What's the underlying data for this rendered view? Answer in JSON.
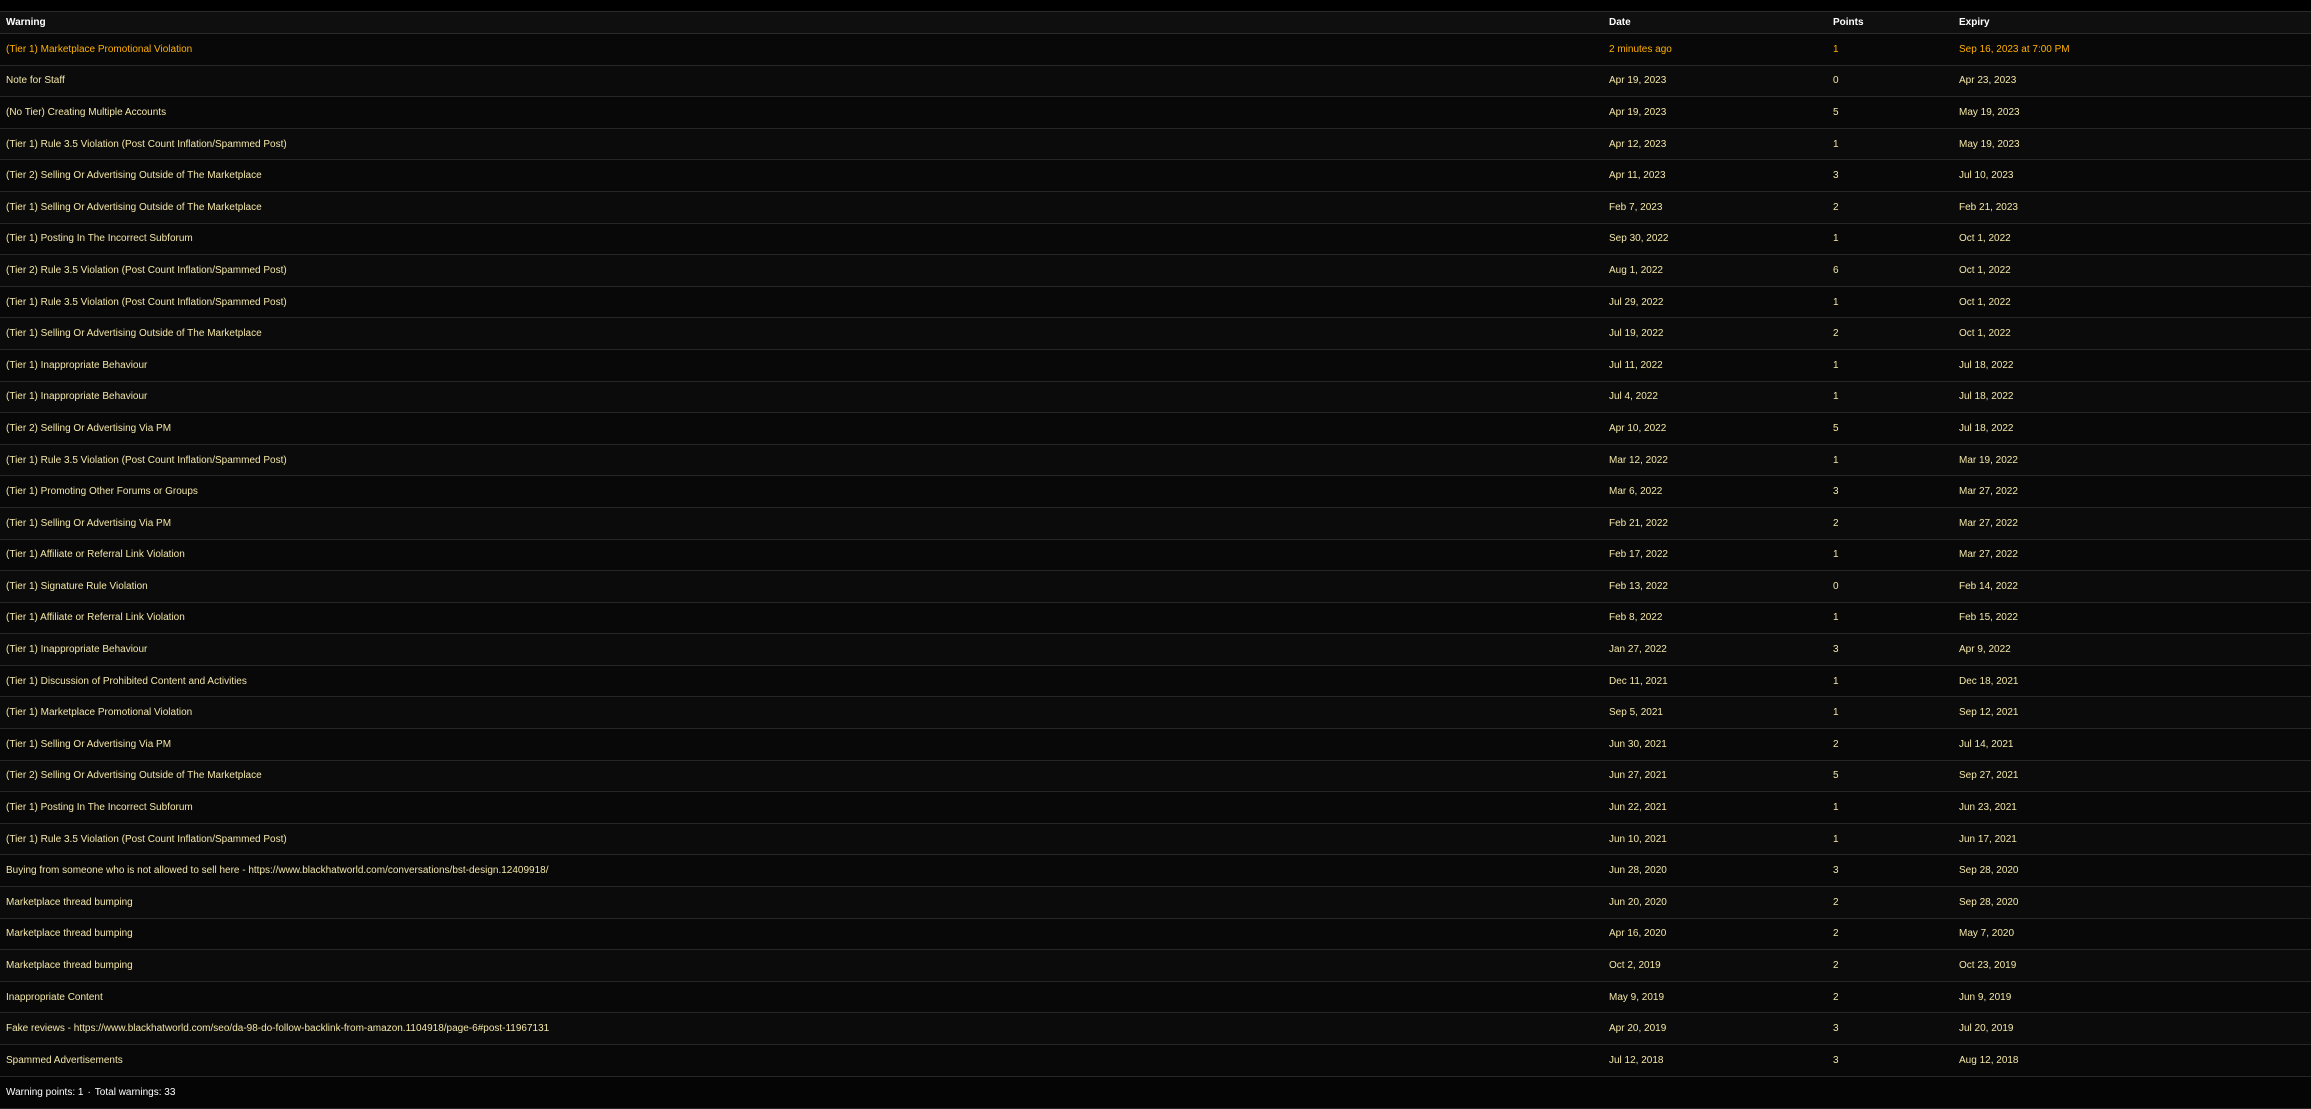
{
  "table": {
    "headers": {
      "warning": "Warning",
      "date": "Date",
      "points": "Points",
      "expiry": "Expiry"
    },
    "rows": [
      {
        "warning": "(Tier 1) Marketplace Promotional Violation",
        "date": "2 minutes ago",
        "points": "1",
        "expiry": "Sep 16, 2023 at 7:00 PM",
        "current": true
      },
      {
        "warning": "Note for Staff",
        "date": "Apr 19, 2023",
        "points": "0",
        "expiry": "Apr 23, 2023"
      },
      {
        "warning": "(No Tier) Creating Multiple Accounts",
        "date": "Apr 19, 2023",
        "points": "5",
        "expiry": "May 19, 2023"
      },
      {
        "warning": "(Tier 1) Rule 3.5 Violation (Post Count Inflation/Spammed Post)",
        "date": "Apr 12, 2023",
        "points": "1",
        "expiry": "May 19, 2023"
      },
      {
        "warning": "(Tier 2) Selling Or Advertising Outside of The Marketplace",
        "date": "Apr 11, 2023",
        "points": "3",
        "expiry": "Jul 10, 2023"
      },
      {
        "warning": "(Tier 1) Selling Or Advertising Outside of The Marketplace",
        "date": "Feb 7, 2023",
        "points": "2",
        "expiry": "Feb 21, 2023"
      },
      {
        "warning": "(Tier 1) Posting In The Incorrect Subforum",
        "date": "Sep 30, 2022",
        "points": "1",
        "expiry": "Oct 1, 2022"
      },
      {
        "warning": "(Tier 2) Rule 3.5 Violation (Post Count Inflation/Spammed Post)",
        "date": "Aug 1, 2022",
        "points": "6",
        "expiry": "Oct 1, 2022"
      },
      {
        "warning": "(Tier 1) Rule 3.5 Violation (Post Count Inflation/Spammed Post)",
        "date": "Jul 29, 2022",
        "points": "1",
        "expiry": "Oct 1, 2022"
      },
      {
        "warning": "(Tier 1) Selling Or Advertising Outside of The Marketplace",
        "date": "Jul 19, 2022",
        "points": "2",
        "expiry": "Oct 1, 2022"
      },
      {
        "warning": "(Tier 1) Inappropriate Behaviour",
        "date": "Jul 11, 2022",
        "points": "1",
        "expiry": "Jul 18, 2022"
      },
      {
        "warning": "(Tier 1) Inappropriate Behaviour",
        "date": "Jul 4, 2022",
        "points": "1",
        "expiry": "Jul 18, 2022"
      },
      {
        "warning": "(Tier 2) Selling Or Advertising Via PM",
        "date": "Apr 10, 2022",
        "points": "5",
        "expiry": "Jul 18, 2022"
      },
      {
        "warning": "(Tier 1) Rule 3.5 Violation (Post Count Inflation/Spammed Post)",
        "date": "Mar 12, 2022",
        "points": "1",
        "expiry": "Mar 19, 2022"
      },
      {
        "warning": "(Tier 1) Promoting Other Forums or Groups",
        "date": "Mar 6, 2022",
        "points": "3",
        "expiry": "Mar 27, 2022"
      },
      {
        "warning": "(Tier 1) Selling Or Advertising Via PM",
        "date": "Feb 21, 2022",
        "points": "2",
        "expiry": "Mar 27, 2022"
      },
      {
        "warning": "(Tier 1) Affiliate or Referral Link Violation",
        "date": "Feb 17, 2022",
        "points": "1",
        "expiry": "Mar 27, 2022"
      },
      {
        "warning": "(Tier 1) Signature Rule Violation",
        "date": "Feb 13, 2022",
        "points": "0",
        "expiry": "Feb 14, 2022"
      },
      {
        "warning": "(Tier 1) Affiliate or Referral Link Violation",
        "date": "Feb 8, 2022",
        "points": "1",
        "expiry": "Feb 15, 2022"
      },
      {
        "warning": "(Tier 1) Inappropriate Behaviour",
        "date": "Jan 27, 2022",
        "points": "3",
        "expiry": "Apr 9, 2022"
      },
      {
        "warning": "(Tier 1) Discussion of Prohibited Content and Activities",
        "date": "Dec 11, 2021",
        "points": "1",
        "expiry": "Dec 18, 2021"
      },
      {
        "warning": "(Tier 1) Marketplace Promotional Violation",
        "date": "Sep 5, 2021",
        "points": "1",
        "expiry": "Sep 12, 2021"
      },
      {
        "warning": "(Tier 1) Selling Or Advertising Via PM",
        "date": "Jun 30, 2021",
        "points": "2",
        "expiry": "Jul 14, 2021"
      },
      {
        "warning": "(Tier 2) Selling Or Advertising Outside of The Marketplace",
        "date": "Jun 27, 2021",
        "points": "5",
        "expiry": "Sep 27, 2021"
      },
      {
        "warning": "(Tier 1) Posting In The Incorrect Subforum",
        "date": "Jun 22, 2021",
        "points": "1",
        "expiry": "Jun 23, 2021"
      },
      {
        "warning": "(Tier 1) Rule 3.5 Violation (Post Count Inflation/Spammed Post)",
        "date": "Jun 10, 2021",
        "points": "1",
        "expiry": "Jun 17, 2021"
      },
      {
        "warning": "Buying from someone who is not allowed to sell here - https://www.blackhatworld.com/conversations/bst-design.12409918/",
        "date": "Jun 28, 2020",
        "points": "3",
        "expiry": "Sep 28, 2020"
      },
      {
        "warning": "Marketplace thread bumping",
        "date": "Jun 20, 2020",
        "points": "2",
        "expiry": "Sep 28, 2020"
      },
      {
        "warning": "Marketplace thread bumping",
        "date": "Apr 16, 2020",
        "points": "2",
        "expiry": "May 7, 2020"
      },
      {
        "warning": "Marketplace thread bumping",
        "date": "Oct 2, 2019",
        "points": "2",
        "expiry": "Oct 23, 2019"
      },
      {
        "warning": "Inappropriate Content",
        "date": "May 9, 2019",
        "points": "2",
        "expiry": "Jun 9, 2019"
      },
      {
        "warning": "Fake reviews - https://www.blackhatworld.com/seo/da-98-do-follow-backlink-from-amazon.1104918/page-6#post-11967131",
        "date": "Apr 20, 2019",
        "points": "3",
        "expiry": "Jul 20, 2019"
      },
      {
        "warning": "Spammed Advertisements",
        "date": "Jul 12, 2018",
        "points": "3",
        "expiry": "Aug 12, 2018"
      }
    ]
  },
  "footer": {
    "points_text": "Warning points: 1",
    "separator": "·",
    "total_text": "Total warnings: 33"
  },
  "colors": {
    "row_text": "#f4e7a6",
    "current_row_text": "#ffb000",
    "header_text": "#ffffff",
    "background": "#070707"
  }
}
